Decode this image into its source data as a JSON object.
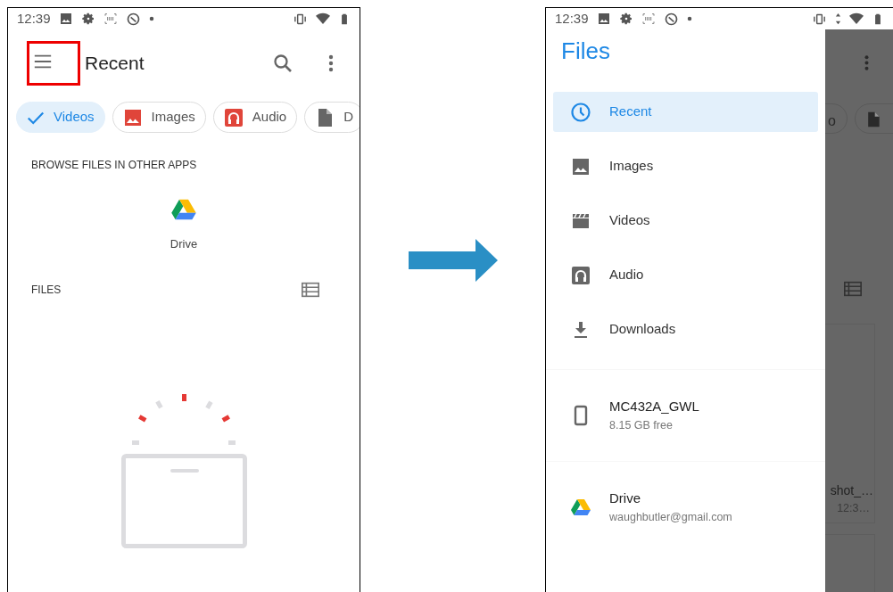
{
  "left_screen": {
    "status_bar": {
      "time": "12:39"
    },
    "app_bar": {
      "title": "Recent",
      "menu_highlighted": true
    },
    "chips": [
      {
        "label": "Videos",
        "selected": true
      },
      {
        "label": "Images",
        "kind": "image",
        "selected": false
      },
      {
        "label": "Audio",
        "kind": "audio",
        "selected": false
      },
      {
        "label": "D",
        "kind": "document",
        "selected": false
      }
    ],
    "browse_heading": "BROWSE FILES IN OTHER APPS",
    "apps": [
      {
        "label": "Drive",
        "kind": "drive"
      }
    ],
    "files_heading": "FILES"
  },
  "right_screen": {
    "status_bar": {
      "time": "12:39"
    },
    "drawer": {
      "title": "Files",
      "items": [
        {
          "label": "Recent",
          "kind": "clock",
          "selected": true
        },
        {
          "label": "Images",
          "kind": "image",
          "selected": false
        },
        {
          "label": "Videos",
          "kind": "video",
          "selected": false
        },
        {
          "label": "Audio",
          "kind": "audio",
          "selected": false
        },
        {
          "label": "Downloads",
          "kind": "download",
          "selected": false
        }
      ],
      "roots": [
        {
          "title": "MC432A_GWL",
          "subtitle": "8.15 GB free",
          "kind": "device"
        },
        {
          "title": "Drive",
          "subtitle": "waughbutler@gmail.com",
          "kind": "drive"
        }
      ]
    },
    "behind": {
      "chip_label": "o",
      "file_name": "shot_…",
      "file_time": "12:3…"
    }
  }
}
